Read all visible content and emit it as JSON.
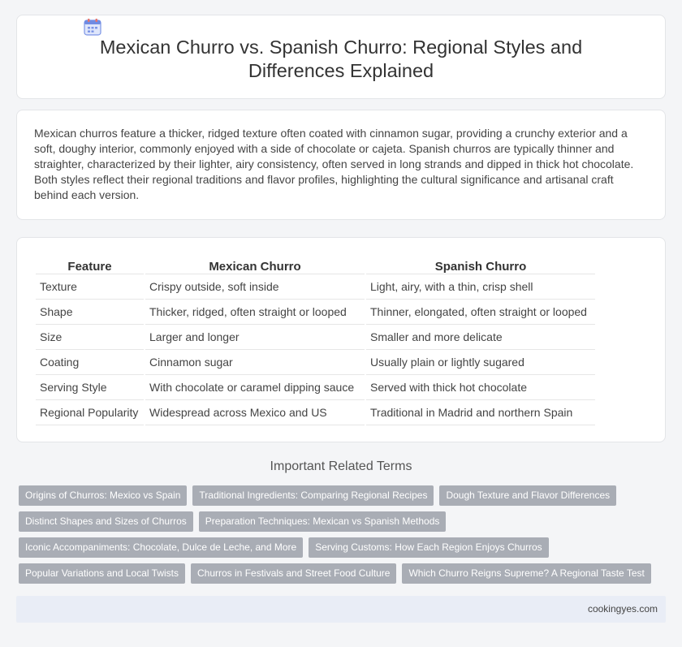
{
  "header": {
    "icon": "calendar-icon",
    "title": "Mexican Churro vs. Spanish Churro: Regional Styles and Differences Explained"
  },
  "intro": {
    "text": "Mexican churros feature a thicker, ridged texture often coated with cinnamon sugar, providing a crunchy exterior and a soft, doughy interior, commonly enjoyed with a side of chocolate or cajeta. Spanish churros are typically thinner and straighter, characterized by their lighter, airy consistency, often served in long strands and dipped in thick hot chocolate. Both styles reflect their regional traditions and flavor profiles, highlighting the cultural significance and artisanal craft behind each version."
  },
  "table": {
    "headers": [
      "Feature",
      "Mexican Churro",
      "Spanish Churro"
    ],
    "rows": [
      [
        "Texture",
        "Crispy outside, soft inside",
        "Light, airy, with a thin, crisp shell"
      ],
      [
        "Shape",
        "Thicker, ridged, often straight or looped",
        "Thinner, elongated, often straight or looped"
      ],
      [
        "Size",
        "Larger and longer",
        "Smaller and more delicate"
      ],
      [
        "Coating",
        "Cinnamon sugar",
        "Usually plain or lightly sugared"
      ],
      [
        "Serving Style",
        "With chocolate or caramel dipping sauce",
        "Served with thick hot chocolate"
      ],
      [
        "Regional Popularity",
        "Widespread across Mexico and US",
        "Traditional in Madrid and northern Spain"
      ]
    ]
  },
  "related": {
    "title": "Important Related Terms",
    "tags": [
      "Origins of Churros: Mexico vs Spain",
      "Traditional Ingredients: Comparing Regional Recipes",
      "Dough Texture and Flavor Differences",
      "Distinct Shapes and Sizes of Churros",
      "Preparation Techniques: Mexican vs Spanish Methods",
      "Iconic Accompaniments: Chocolate, Dulce de Leche, and More",
      "Serving Customs: How Each Region Enjoys Churros",
      "Popular Variations and Local Twists",
      "Churros in Festivals and Street Food Culture",
      "Which Churro Reigns Supreme? A Regional Taste Test"
    ]
  },
  "footer": {
    "site": "cookingyes.com"
  }
}
